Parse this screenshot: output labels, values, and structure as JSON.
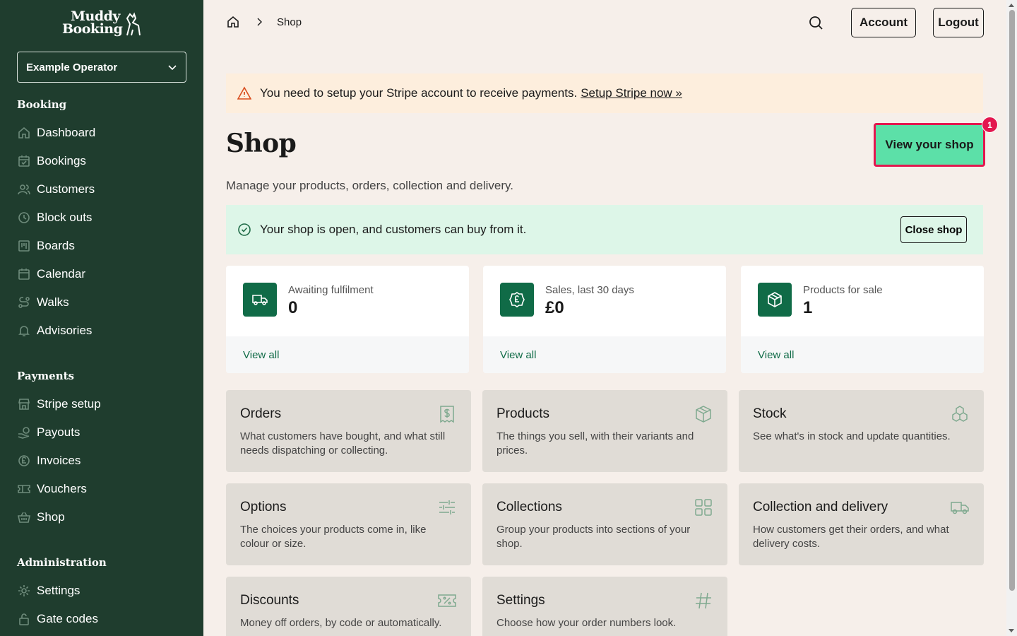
{
  "brand": {
    "logo_line1": "Muddy",
    "logo_line2": "Booking"
  },
  "operator": {
    "selected": "Example Operator"
  },
  "sidebar": {
    "sections": [
      {
        "title": "Booking"
      },
      {
        "title": "Payments"
      },
      {
        "title": "Administration"
      }
    ],
    "items": [
      {
        "label": "Dashboard",
        "icon": "home-icon"
      },
      {
        "label": "Bookings",
        "icon": "calendar-check-icon"
      },
      {
        "label": "Customers",
        "icon": "users-icon"
      },
      {
        "label": "Block outs",
        "icon": "clock-icon"
      },
      {
        "label": "Boards",
        "icon": "board-icon"
      },
      {
        "label": "Calendar",
        "icon": "calendar-icon"
      },
      {
        "label": "Walks",
        "icon": "route-icon"
      },
      {
        "label": "Advisories",
        "icon": "bell-icon"
      },
      {
        "label": "Stripe setup",
        "icon": "store-icon"
      },
      {
        "label": "Payouts",
        "icon": "payouts-icon"
      },
      {
        "label": "Invoices",
        "icon": "pound-icon"
      },
      {
        "label": "Vouchers",
        "icon": "ticket-icon"
      },
      {
        "label": "Shop",
        "icon": "basket-icon"
      },
      {
        "label": "Settings",
        "icon": "gear-icon"
      },
      {
        "label": "Gate codes",
        "icon": "lock-icon"
      }
    ]
  },
  "header": {
    "breadcrumb": {
      "current": "Shop"
    },
    "account_label": "Account",
    "logout_label": "Logout"
  },
  "warning": {
    "text": "You need to setup your Stripe account to receive payments.",
    "link": "Setup Stripe now »"
  },
  "page": {
    "title": "Shop",
    "subtitle": "Manage your products, orders, collection and delivery.",
    "view_shop_label": "View your shop",
    "view_shop_badge": "1"
  },
  "shop_status": {
    "text": "Your shop is open, and customers can buy from it.",
    "close_label": "Close shop"
  },
  "stats": [
    {
      "label": "Awaiting fulfilment",
      "value": "0",
      "link": "View all",
      "icon": "truck-icon"
    },
    {
      "label": "Sales, last 30 days",
      "value": "£0",
      "link": "View all",
      "icon": "pound-badge-icon"
    },
    {
      "label": "Products for sale",
      "value": "1",
      "link": "View all",
      "icon": "box-icon"
    }
  ],
  "tiles": [
    {
      "title": "Orders",
      "desc": "What customers have bought, and what still needs dispatching or collecting.",
      "icon": "receipt-icon"
    },
    {
      "title": "Products",
      "desc": "The things you sell, with their variants and prices.",
      "icon": "box-icon"
    },
    {
      "title": "Stock",
      "desc": "See what's in stock and update quantities.",
      "icon": "stack-icon"
    },
    {
      "title": "Options",
      "desc": "The choices your products come in, like colour or size.",
      "icon": "sliders-icon"
    },
    {
      "title": "Collections",
      "desc": "Group your products into sections of your shop.",
      "icon": "grid-icon"
    },
    {
      "title": "Collection and delivery",
      "desc": "How customers get their orders, and what delivery costs.",
      "icon": "truck-icon"
    },
    {
      "title": "Discounts",
      "desc": "Money off orders, by code or automatically.",
      "icon": "discount-ticket-icon"
    },
    {
      "title": "Settings",
      "desc": "Choose how your order numbers look.",
      "icon": "hash-icon"
    }
  ]
}
